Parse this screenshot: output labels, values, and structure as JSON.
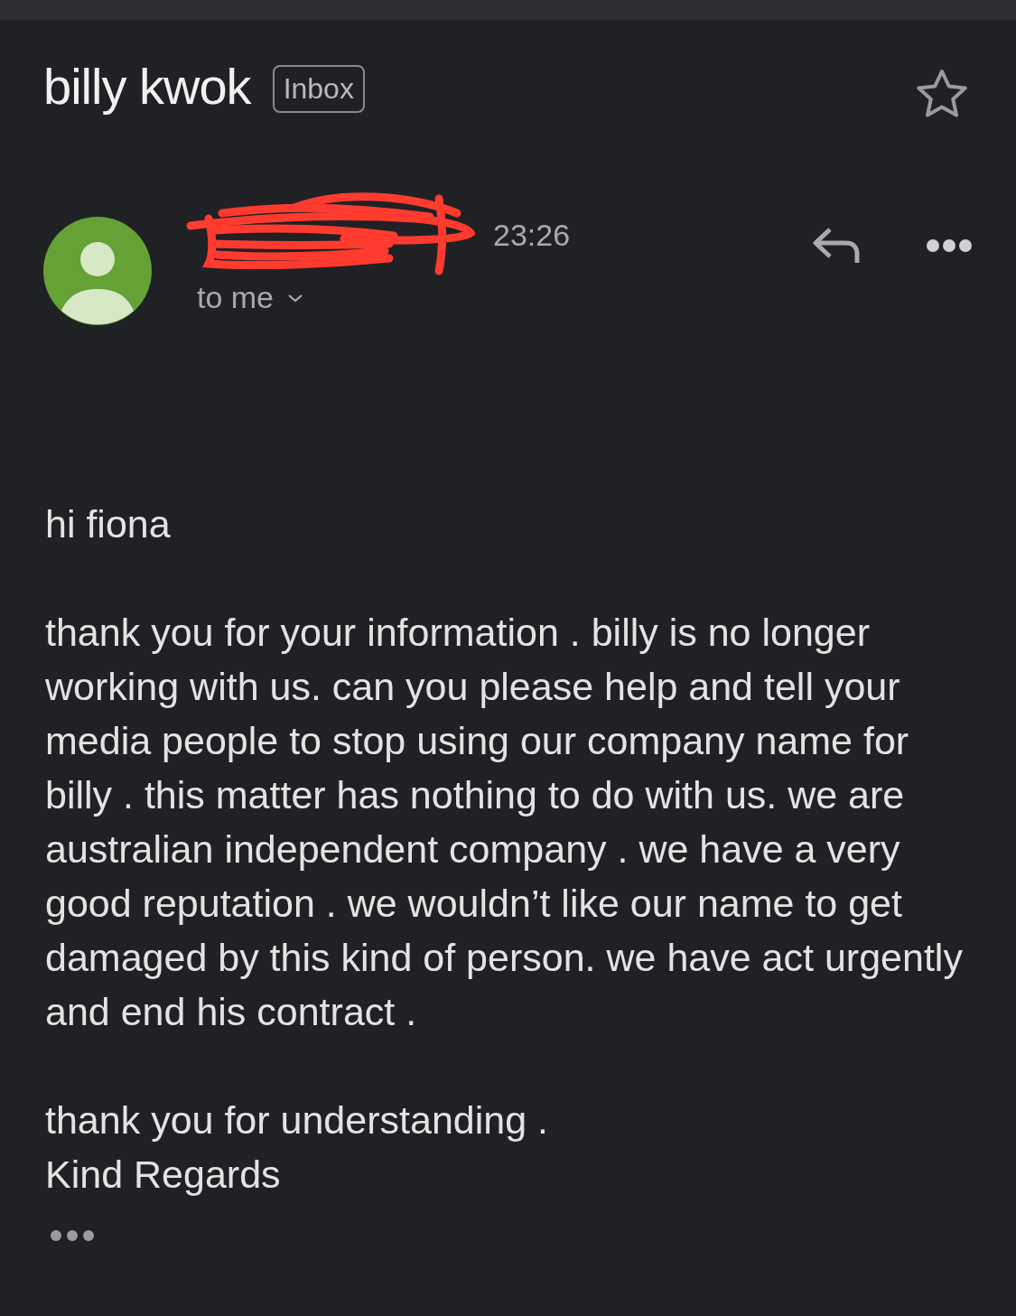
{
  "header": {
    "subject": "billy kwok",
    "label": "Inbox",
    "starred": false
  },
  "message": {
    "time": "23:26",
    "recipient": "to me"
  },
  "body": [
    {
      "kind": "paragraph",
      "text": "hi fiona"
    },
    {
      "kind": "paragraph",
      "text": "thank you for your information . billy is no longer working with us. can you please help and tell your media people to stop using our company name for billy . this matter has nothing to do with us. we are australian independent company . we have a very good reputation . we wouldn’t like our name to get damaged by this kind of person. we have act urgently and end his contract ."
    },
    {
      "kind": "line",
      "text": "thank you for understanding ."
    },
    {
      "kind": "line",
      "text": "Kind Regards"
    }
  ]
}
